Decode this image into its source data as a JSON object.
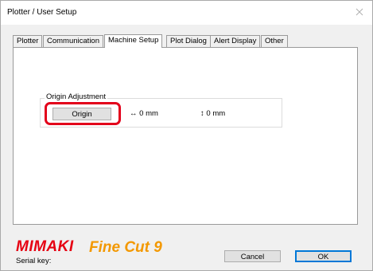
{
  "window": {
    "title": "Plotter / User Setup"
  },
  "tabs": [
    {
      "label": "Plotter",
      "active": false
    },
    {
      "label": "Communication",
      "active": false
    },
    {
      "label": "Machine Setup",
      "active": true
    },
    {
      "label": "Plot Dialog",
      "active": false
    },
    {
      "label": "Alert Display",
      "active": false
    },
    {
      "label": "Other",
      "active": false
    }
  ],
  "origin_adjustment": {
    "label": "Origin Adjustment",
    "button_label": "Origin",
    "horizontal_glyph": "↔",
    "horizontal_value": "0 mm",
    "vertical_glyph": "↕",
    "vertical_value": "0 mm"
  },
  "footer": {
    "logo": {
      "brand": "MIMAKI",
      "product": "Fine Cut 9"
    },
    "serial_label": "Serial key:",
    "cancel_label": "Cancel",
    "ok_label": "OK"
  },
  "colors": {
    "highlight": "#e3001b",
    "mimaki_red": "#e60012",
    "finecut_orange": "#f39800",
    "default_button_border": "#0078d7"
  },
  "icons": {
    "close": "close-icon"
  }
}
